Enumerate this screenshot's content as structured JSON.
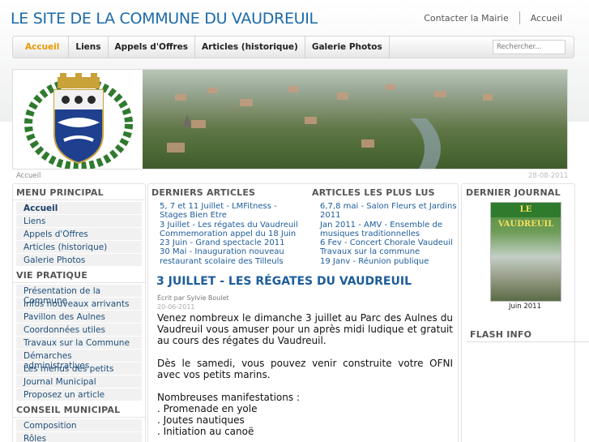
{
  "site": {
    "title": "LE SITE DE LA COMMUNE DU VAUDREUIL"
  },
  "toplinks": [
    "Contacter la Mairie",
    "Accueil"
  ],
  "nav": {
    "tabs": [
      "Accueil",
      "Liens",
      "Appels d'Offres",
      "Articles (historique)",
      "Galerie Photos"
    ],
    "search_placeholder": "Rechercher..."
  },
  "breadcrumb": "Accueil",
  "date": "28-08-2011",
  "left": {
    "menu_principal": {
      "title": "MENU PRINCIPAL",
      "items": [
        "Accueil",
        "Liens",
        "Appels d'Offres",
        "Articles (historique)",
        "Galerie Photos"
      ]
    },
    "vie_pratique": {
      "title": "VIE PRATIQUE",
      "items": [
        "Présentation de la Commune",
        "Infos nouveaux arrivants",
        "Pavillon des Aulnes",
        "Coordonnées utiles",
        "Travaux sur la Commune",
        "Démarches administratives",
        "Les menus des petits",
        "Journal Municipal",
        "Proposez un article"
      ]
    },
    "conseil": {
      "title": "CONSEIL MUNICIPAL",
      "items": [
        "Composition",
        "Rôles"
      ]
    }
  },
  "middle": {
    "latest_title": "DERNIERS ARTICLES",
    "popular_title": "ARTICLES LES PLUS LUS",
    "latest": [
      "5, 7 et 11 Juillet - LMFitness - Stages Bien Etre",
      "3 Juillet - Les régates du Vaudreuil",
      "Commemoration appel du 18 Juin",
      "23 Juin - Grand spectacle 2011",
      "30 Mai - Inauguration nouveau restaurant scolaire des Tilleuls"
    ],
    "popular": [
      "6,7,8 mai - Salon Fleurs et Jardins 2011",
      "Jan 2011 - AMV - Ensemble de musiques traditionnelles",
      "6 Fev - Concert Chorale Vaudeuil",
      "Travaux sur la commune",
      "19 Janv - Réunion publique"
    ],
    "article": {
      "title": "3 JUILLET - LES RÉGATES DU VAUDREUIL",
      "byline": "Écrit par Sylvie Boulet",
      "date": "20-06-2011",
      "p1": "Venez nombreux le dimanche 3 juillet au Parc des Aulnes du Vaudreuil vous amuser pour un après midi ludique et gratuit au cours des régates du Vaudreuil.",
      "p2": "Dès le samedi, vous pouvez venir construite votre OFNI avec vos petits marins.",
      "list_intro": "Nombreuses manifestations :",
      "list": [
        ". Promenade en yole",
        ". Joutes nautiques",
        ". Initiation au canoë"
      ]
    }
  },
  "right": {
    "journal_title": "DERNIER JOURNAL",
    "journal_masthead": "LE VAUDREUIL",
    "journal_caption": "Juin 2011",
    "flash_title": "FLASH INFO"
  }
}
